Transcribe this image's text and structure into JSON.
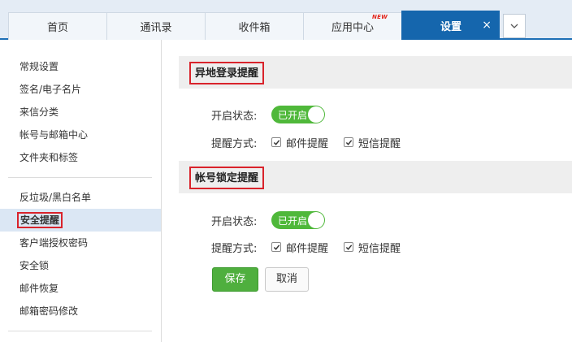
{
  "tabs": [
    {
      "label": "首页"
    },
    {
      "label": "通讯录"
    },
    {
      "label": "收件箱"
    },
    {
      "label": "应用中心",
      "badge": "NEW"
    },
    {
      "label": "设置",
      "close": "×"
    }
  ],
  "sidebar": {
    "group1": [
      "常规设置",
      "签名/电子名片",
      "来信分类",
      "帐号与邮箱中心",
      "文件夹和标签"
    ],
    "group2": [
      "反垃圾/黑白名单",
      "安全提醒",
      "客户端授权密码",
      "安全锁",
      "邮件恢复",
      "邮箱密码修改"
    ],
    "active": "安全提醒"
  },
  "sections": [
    {
      "title": "异地登录提醒",
      "status_label": "开启状态:",
      "toggle_text": "已开启",
      "method_label": "提醒方式:",
      "options": [
        {
          "label": "邮件提醒",
          "checked": true
        },
        {
          "label": "短信提醒",
          "checked": true
        }
      ]
    },
    {
      "title": "帐号锁定提醒",
      "status_label": "开启状态:",
      "toggle_text": "已开启",
      "method_label": "提醒方式:",
      "options": [
        {
          "label": "邮件提醒",
          "checked": true
        },
        {
          "label": "短信提醒",
          "checked": true
        }
      ]
    }
  ],
  "buttons": {
    "save": "保存",
    "cancel": "取消"
  },
  "colors": {
    "accent": "#1566ad",
    "toggle_on": "#4fb83a",
    "highlight": "#d9232b",
    "save": "#4faf3e"
  }
}
